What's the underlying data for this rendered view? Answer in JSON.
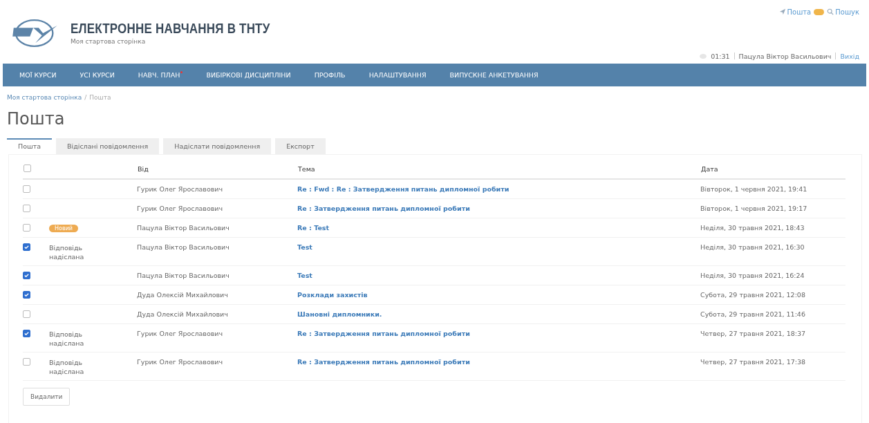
{
  "top_links": {
    "mail": "Пошта",
    "search": "Пошук"
  },
  "header": {
    "title": "ЕЛЕКТРОННЕ НАВЧАННЯ В ТНТУ",
    "subtitle": "Моя стартова сторінка"
  },
  "user_bar": {
    "time": "01:31",
    "user": "Пацула Віктор Васильович",
    "logout": "Вихід"
  },
  "nav": [
    {
      "label": "МОЇ КУРСИ",
      "alert": false
    },
    {
      "label": "УСІ КУРСИ",
      "alert": false
    },
    {
      "label": "НАВЧ. ПЛАН",
      "alert": true
    },
    {
      "label": "ВИБІРКОВІ ДИСЦИПЛІНИ",
      "alert": false
    },
    {
      "label": "ПРОФІЛЬ",
      "alert": false
    },
    {
      "label": "НАЛАШТУВАННЯ",
      "alert": false
    },
    {
      "label": "ВИПУСКНЕ АНКЕТУВАННЯ",
      "alert": false
    }
  ],
  "breadcrumb": {
    "home": "Моя стартова сторінка",
    "separator": "/",
    "current": "Пошта"
  },
  "page_title": "Пошта",
  "tabs": [
    {
      "label": "Пошта",
      "selected": true
    },
    {
      "label": "Відіслані повідомлення",
      "selected": false
    },
    {
      "label": "Надіслати повідомлення",
      "selected": false
    },
    {
      "label": "Експорт",
      "selected": false
    }
  ],
  "table": {
    "select_all": false,
    "columns": [
      "Від",
      "Тема",
      "Дата"
    ],
    "rows": [
      {
        "checked": false,
        "from": "Гурик Олег Ярославович",
        "subject": "Re : Fwd : Re : Затвердження питань дипломної робити",
        "date": "Вівторок, 1 червня 2021, 19:41"
      },
      {
        "checked": false,
        "from": "Гурик Олег Ярославович",
        "subject": "Re : Затвердження питань дипломної робити",
        "date": "Вівторок, 1 червня 2021, 19:17"
      },
      {
        "checked": false,
        "badge": "Новий",
        "from": "Пацула Віктор Васильович",
        "subject": "Re : Test",
        "date": "Неділя, 30 травня 2021, 18:43"
      },
      {
        "checked": true,
        "status": "Відповідь надіслана",
        "from": "Пацула Віктор Васильович",
        "subject": "Test",
        "date": "Неділя, 30 травня 2021, 16:30"
      },
      {
        "checked": true,
        "from": "Пацула Віктор Васильович",
        "subject": "Test",
        "date": "Неділя, 30 травня 2021, 16:24"
      },
      {
        "checked": true,
        "from": "Дуда Олексій Михайлович",
        "subject": "Розклади захистів",
        "date": "Субота, 29 травня 2021, 12:08"
      },
      {
        "checked": false,
        "from": "Дуда Олексій Михайлович",
        "subject": "Шановні дипломники.",
        "date": "Субота, 29 травня 2021, 11:46"
      },
      {
        "checked": true,
        "status": "Відповідь надіслана",
        "from": "Гурик Олег Ярославович",
        "subject": "Re : Затвердження питань дипломної робити",
        "date": "Четвер, 27 травня 2021, 18:37"
      },
      {
        "checked": false,
        "status": "Відповідь надіслана",
        "from": "Гурик Олег Ярославович",
        "subject": "Re : Затвердження питань дипломної робити",
        "date": "Четвер, 27 травня 2021, 17:38"
      }
    ]
  },
  "delete_button": "Видалити"
}
